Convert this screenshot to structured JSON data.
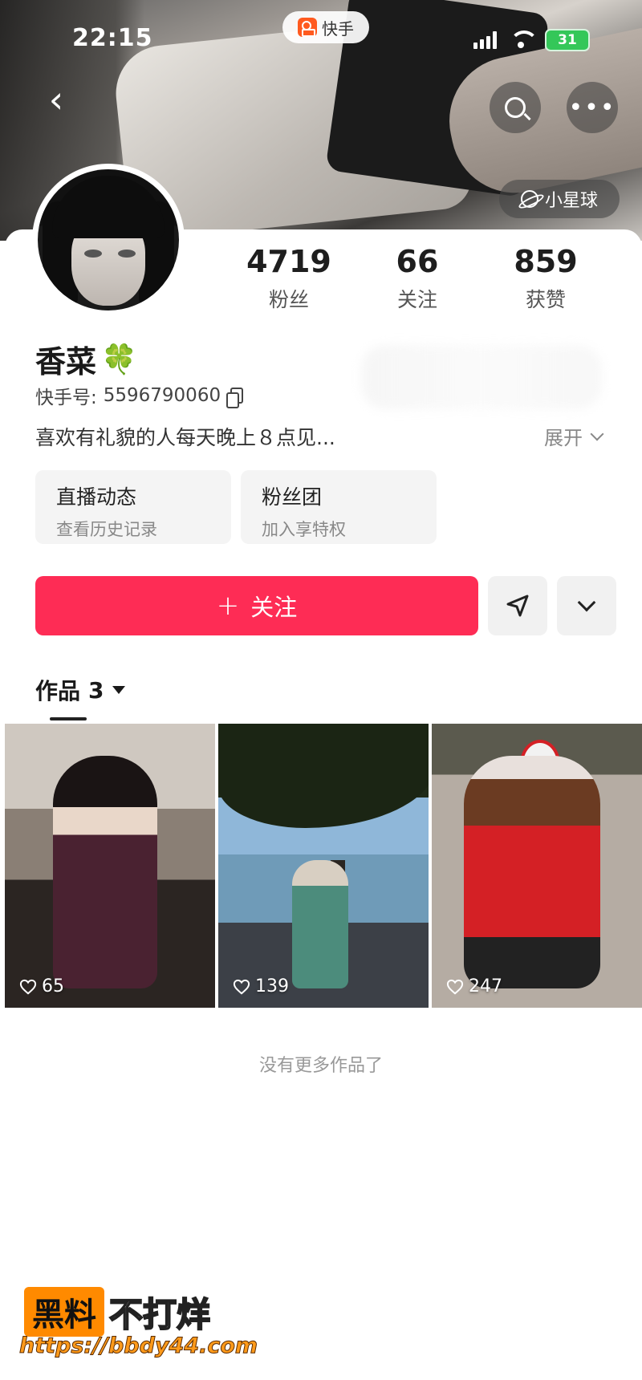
{
  "status_bar": {
    "time": "22:15",
    "app_name": "快手",
    "battery": "31"
  },
  "header": {
    "planet_label": "小星球"
  },
  "profile": {
    "name": "香菜",
    "name_emoji": "🍀",
    "kuaishou_id_label": "快手号:",
    "kuaishou_id": "5596790060",
    "bio": "喜欢有礼貌的人每天晚上８点见...",
    "expand_label": "展开"
  },
  "stats": [
    {
      "value": "4719",
      "label": "粉丝"
    },
    {
      "value": "66",
      "label": "关注"
    },
    {
      "value": "859",
      "label": "获赞"
    }
  ],
  "cards": [
    {
      "title": "直播动态",
      "subtitle": "查看历史记录"
    },
    {
      "title": "粉丝团",
      "subtitle": "加入享特权"
    }
  ],
  "actions": {
    "follow_plus": "+",
    "follow_label": "关注"
  },
  "works": {
    "tab_label": "作品",
    "count": "3",
    "items": [
      {
        "likes": "65"
      },
      {
        "likes": "139"
      },
      {
        "likes": "247"
      }
    ],
    "no_more": "没有更多作品了"
  },
  "watermark": {
    "brand_box": "黑料",
    "brand_text": "不打烊",
    "url": "https://bbdy44.com"
  },
  "icons": {
    "back": "chevron-left-icon",
    "search": "search-icon",
    "more": "more-icon",
    "planet": "planet-icon",
    "copy": "copy-icon",
    "share": "paper-plane-icon",
    "dropdown": "chevron-down-icon",
    "heart": "heart-icon"
  },
  "colors": {
    "accent": "#fe2c55",
    "battery": "#34c759"
  }
}
